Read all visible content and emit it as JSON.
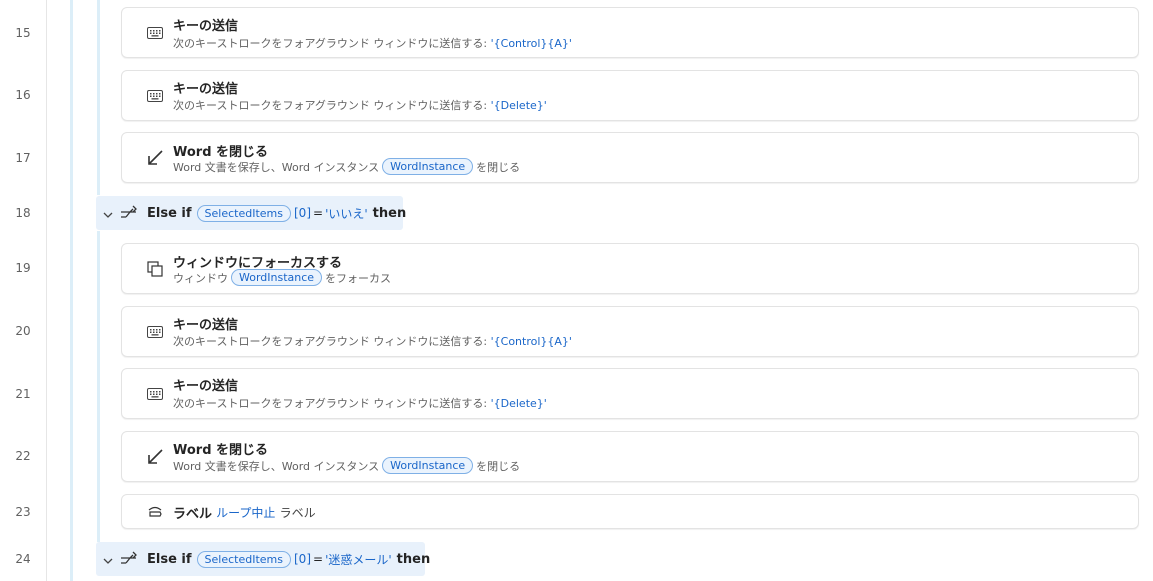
{
  "lines": [
    "15",
    "16",
    "17",
    "18",
    "19",
    "20",
    "21",
    "22",
    "23",
    "24"
  ],
  "actions": {
    "send_keys_1": {
      "title": "キーの送信",
      "desc": "次のキーストロークをフォアグラウンド ウィンドウに送信する:",
      "value": "'{Control}{A}'"
    },
    "send_keys_2": {
      "title": "キーの送信",
      "desc": "次のキーストロークをフォアグラウンド ウィンドウに送信する:",
      "value": "'{Delete}'"
    },
    "close_word_1": {
      "title": "Word を閉じる",
      "desc_pre": "Word 文書を保存し、Word インスタンス",
      "chip": "WordInstance",
      "desc_post": "を閉じる"
    },
    "else_if_1": {
      "keyword": "Else if",
      "variable": "SelectedItems",
      "index": "[0]",
      "op": "=",
      "value": "'いいえ'",
      "then": "then"
    },
    "focus_window": {
      "title": "ウィンドウにフォーカスする",
      "desc_pre": "ウィンドウ",
      "chip": "WordInstance",
      "desc_post": "をフォーカス"
    },
    "send_keys_3": {
      "title": "キーの送信",
      "desc": "次のキーストロークをフォアグラウンド ウィンドウに送信する:",
      "value": "'{Control}{A}'"
    },
    "send_keys_4": {
      "title": "キーの送信",
      "desc": "次のキーストロークをフォアグラウンド ウィンドウに送信する:",
      "value": "'{Delete}'"
    },
    "close_word_2": {
      "title": "Word を閉じる",
      "desc_pre": "Word 文書を保存し、Word インスタンス",
      "chip": "WordInstance",
      "desc_post": "を閉じる"
    },
    "label": {
      "title": "ラベル",
      "name": "ループ中止",
      "suffix": "ラベル"
    },
    "else_if_2": {
      "keyword": "Else if",
      "variable": "SelectedItems",
      "index": "[0]",
      "op": "=",
      "value": "'迷惑メール'",
      "then": "then"
    }
  },
  "icons": [
    "keyboard-icon",
    "close-arrow-icon",
    "branch-icon",
    "chevron-down-icon",
    "focus-window-icon",
    "label-icon"
  ],
  "colors": {
    "accent": "#1a66c9",
    "chip_bg": "#eaf3fd",
    "rail": "#dceef8",
    "elseif_bg": "#e8f1fb"
  }
}
